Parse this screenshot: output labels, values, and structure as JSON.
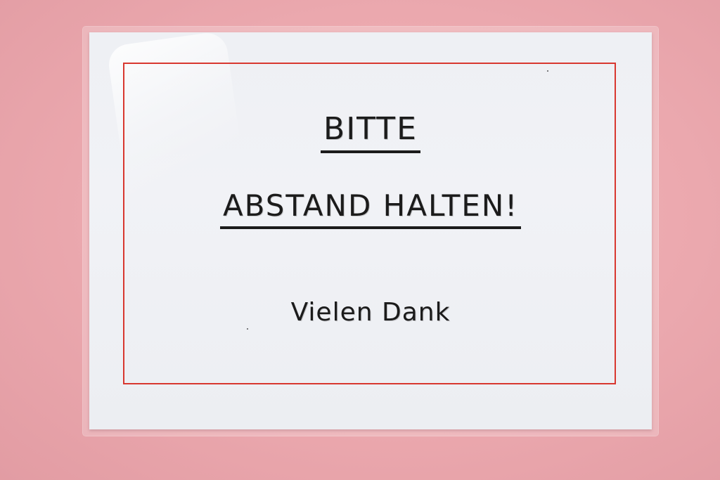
{
  "sign": {
    "line1": "BITTE",
    "line2": "ABSTAND HALTEN!",
    "line3": "Vielen Dank"
  },
  "colors": {
    "wall": "#eba8ae",
    "paper": "#eef0f4",
    "frame": "#d8372f",
    "text": "#1b1b1b"
  }
}
